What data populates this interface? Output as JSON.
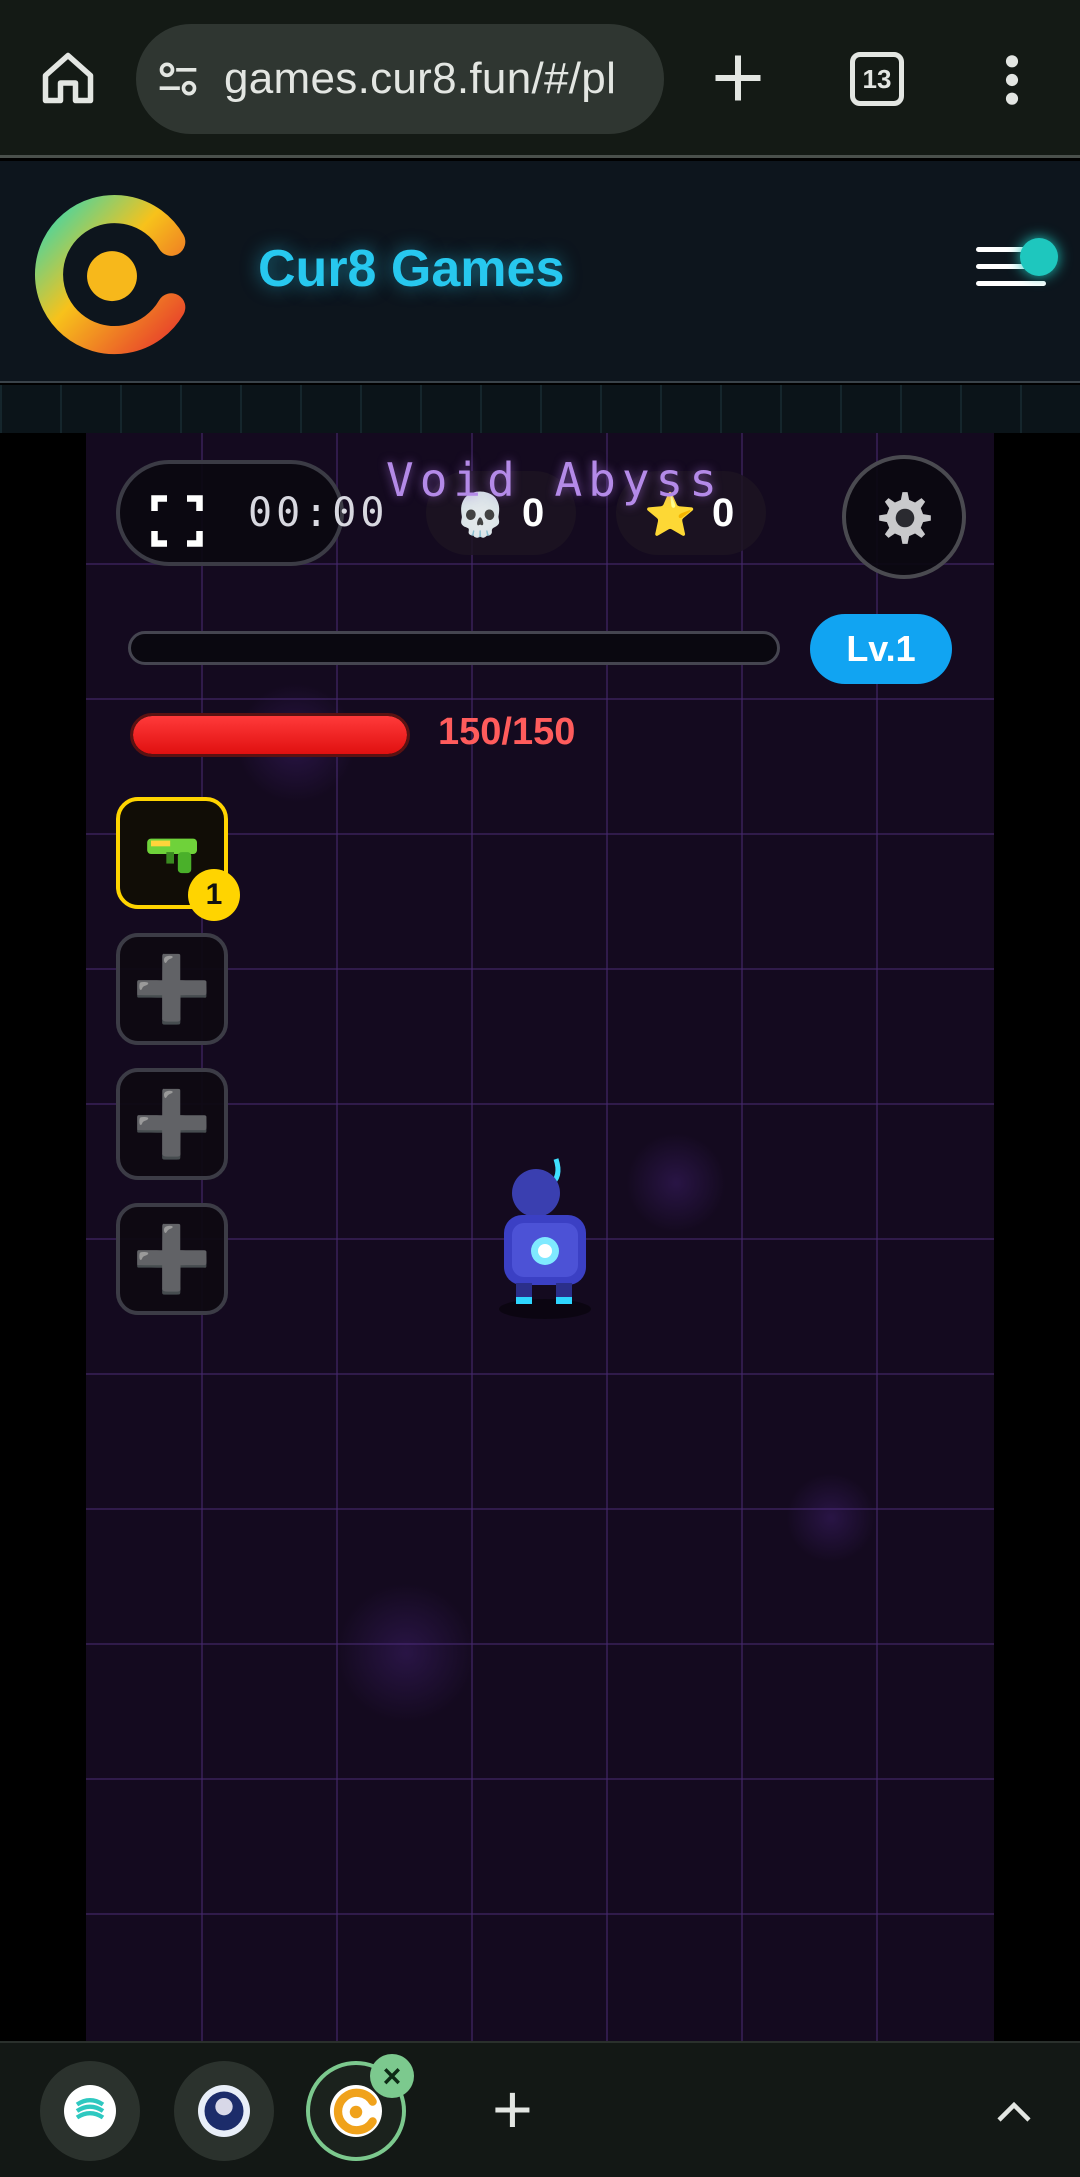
{
  "browser": {
    "url": "games.cur8.fun/#/pl",
    "tab_count": "13"
  },
  "site": {
    "title": "Cur8 Games"
  },
  "game": {
    "title": "Void Abyss",
    "timer": "00:00",
    "kills": "0",
    "stars": "0",
    "level": "Lv.1",
    "xp_progress": 0,
    "hp": "150/150",
    "hp_fraction": 1.0,
    "weapon_slots": [
      {
        "item": "water-gun",
        "count": "1",
        "active": true
      },
      {
        "item": "empty",
        "symbol": "➕"
      },
      {
        "item": "empty",
        "symbol": "➕"
      },
      {
        "item": "empty",
        "symbol": "➕"
      }
    ]
  },
  "colors": {
    "accent": "#27c8ef",
    "level_badge": "#11a4f2",
    "hp": "#ff3a3a",
    "slot_active": "#ffd400"
  }
}
